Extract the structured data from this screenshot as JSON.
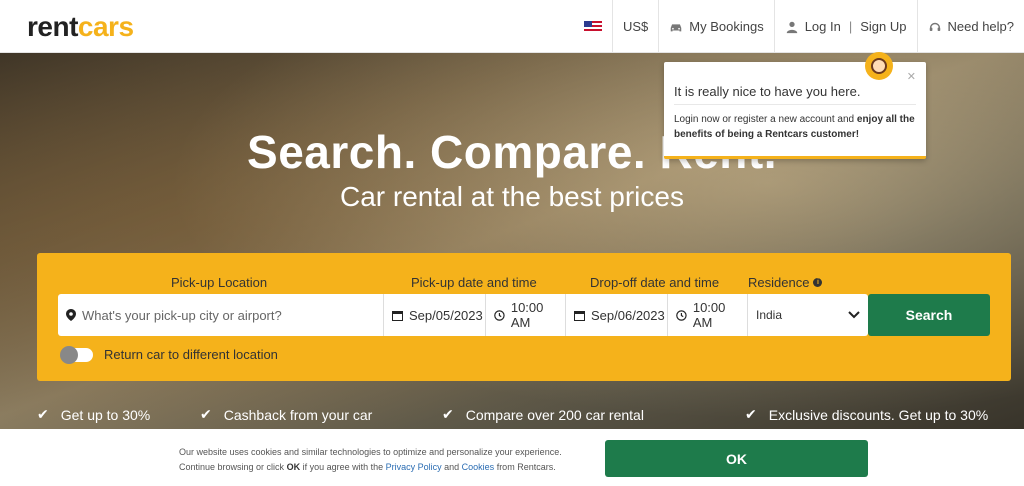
{
  "header": {
    "logo_text_a": "rent",
    "logo_text_b": "cars",
    "currency": "US$",
    "my_bookings": "My Bookings",
    "login": "Log In",
    "signup": "Sign Up",
    "help": "Need help?"
  },
  "hero": {
    "title": "Search. Compare. Rent.",
    "subtitle": "Car rental at the best prices"
  },
  "search": {
    "label_pickup_location": "Pick-up Location",
    "label_pickup_datetime": "Pick-up date and time",
    "label_dropoff_datetime": "Drop-off date and time",
    "label_residence": "Residence",
    "location_placeholder": "What's your pick-up city or airport?",
    "pickup_date": "Sep/05/2023",
    "pickup_time": "10:00 AM",
    "dropoff_date": "Sep/06/2023",
    "dropoff_time": "10:00 AM",
    "residence": "India",
    "search_button": "Search",
    "return_label": "Return car to different location"
  },
  "benefits": [
    "Get up to 30%",
    "Cashback from your car",
    "Compare over 200 car rental",
    "Exclusive discounts. Get up to 30%"
  ],
  "popup": {
    "title": "It is really nice to have you here.",
    "text_a": "Login now or register a new account and ",
    "text_b": "enjoy all the benefits of being a Rentcars customer!"
  },
  "cookie": {
    "text_a": "Our website uses cookies and similar technologies to optimize and personalize your experience. Continue browsing or click ",
    "ok_word": "OK",
    "text_b": " if you agree with the ",
    "privacy_link": "Privacy Policy",
    "and": " and ",
    "cookies_link": "Cookies",
    "text_c": " from Rentcars.",
    "ok_button": "OK"
  },
  "colors": {
    "brand_yellow": "#f5b21b",
    "brand_green": "#1e7b4b"
  }
}
